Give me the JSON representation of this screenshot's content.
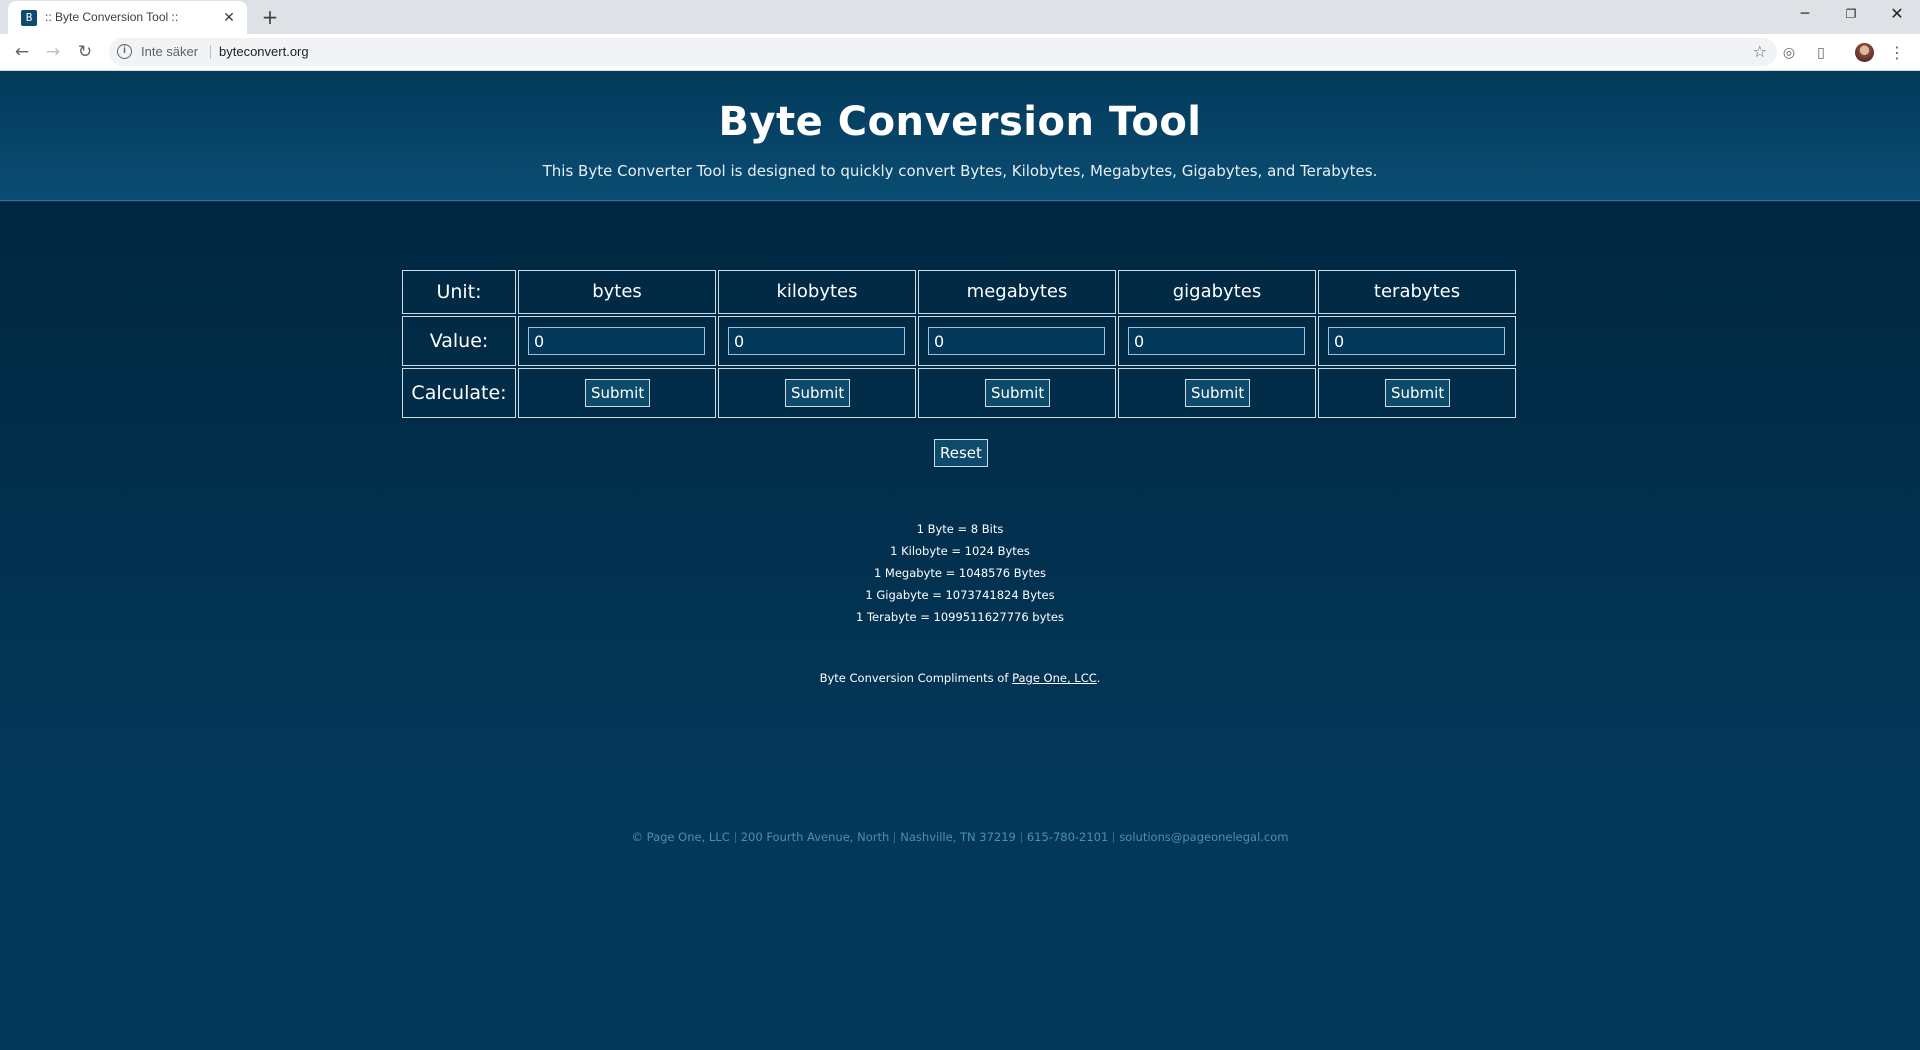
{
  "browser": {
    "tab_title": ":: Byte Conversion Tool ::",
    "favicon_glyph": "B",
    "new_tab_label": "+",
    "security_label": "Inte säker",
    "url": "byteconvert.org"
  },
  "hero": {
    "title": "Byte Conversion Tool",
    "subtitle": "This Byte Converter Tool is designed to quickly convert Bytes, Kilobytes, Megabytes, Gigabytes, and Terabytes."
  },
  "converter": {
    "unit_label": "Unit:",
    "value_label": "Value:",
    "calculate_label": "Calculate:",
    "units": [
      {
        "name": "bytes",
        "value": "0",
        "submit": "Submit"
      },
      {
        "name": "kilobytes",
        "value": "0",
        "submit": "Submit"
      },
      {
        "name": "megabytes",
        "value": "0",
        "submit": "Submit"
      },
      {
        "name": "gigabytes",
        "value": "0",
        "submit": "Submit"
      },
      {
        "name": "terabytes",
        "value": "0",
        "submit": "Submit"
      }
    ],
    "reset_label": "Reset"
  },
  "facts": [
    "1 Byte = 8 Bits",
    "1 Kilobyte = 1024 Bytes",
    "1 Megabyte = 1048576 Bytes",
    "1 Gigabyte = 1073741824 Bytes",
    "1 Terabyte = 1099511627776 bytes"
  ],
  "credit": {
    "prefix": "Byte Conversion Compliments of ",
    "link": "Page One, LCC",
    "suffix": "."
  },
  "footer": {
    "company": "© Page One, LLC",
    "address": "200 Fourth Avenue, North",
    "city": "Nashville, TN 37219",
    "phone": "615-780-2101",
    "email": "solutions@pageonelegal.com"
  },
  "colors": {
    "page_bg": "#03385a",
    "hero_bg": "#0a4d72",
    "main_bg_top": "#012740",
    "footer_text": "#4a8fb5",
    "border": "#cfdbe3"
  }
}
